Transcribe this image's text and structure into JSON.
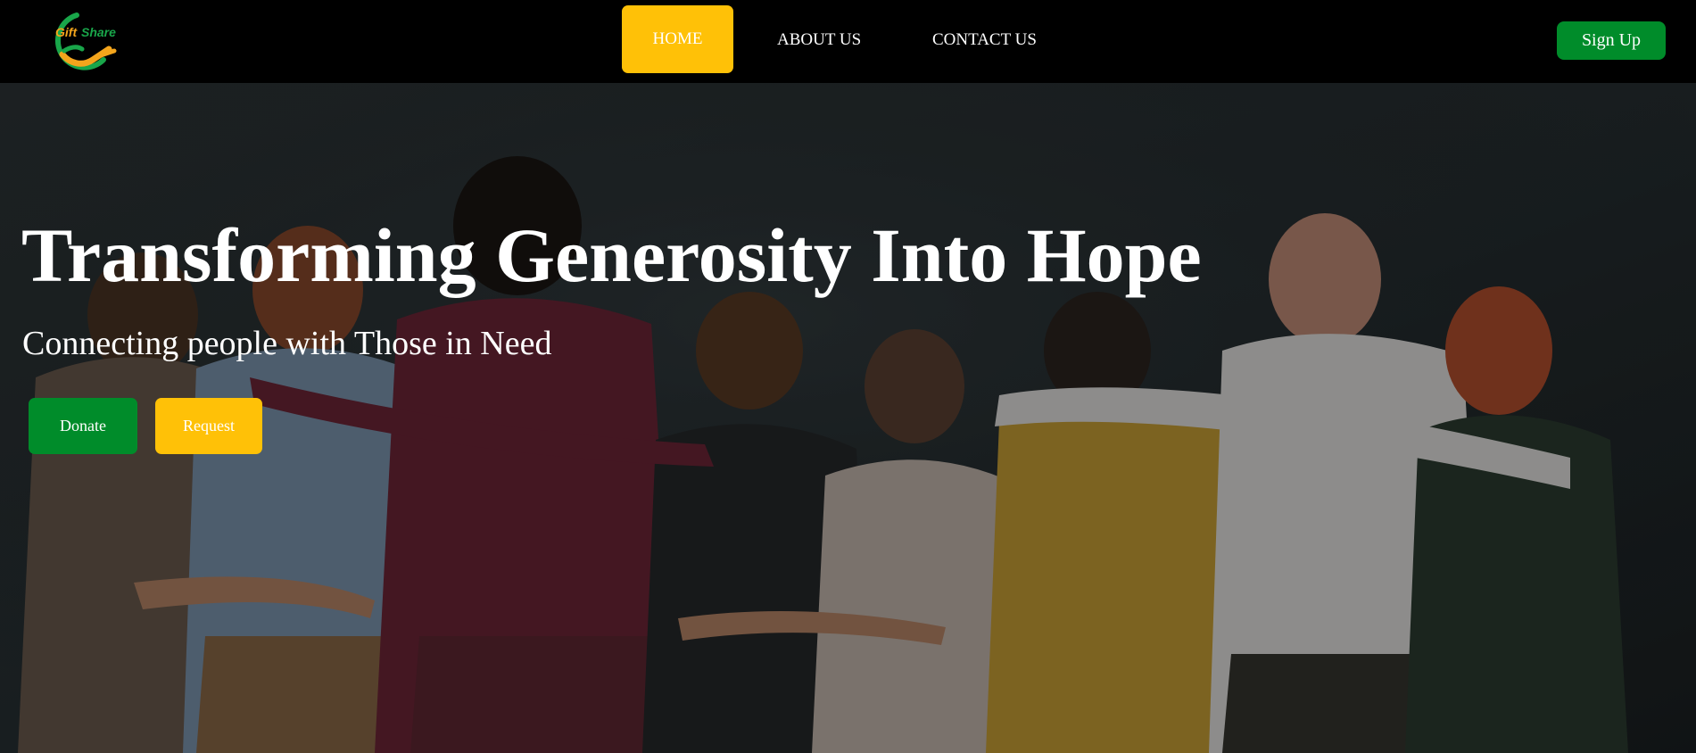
{
  "brand": {
    "name_part1": "Gift",
    "name_part2": "Share",
    "colors": {
      "green": "#008c2a",
      "yellow": "#ffc107",
      "nav_background": "#000000"
    }
  },
  "nav": {
    "items": [
      {
        "label": "HOME",
        "active": true
      },
      {
        "label": "ABOUT US",
        "active": false
      },
      {
        "label": "CONTACT US",
        "active": false
      }
    ],
    "signup_label": "Sign Up"
  },
  "hero": {
    "title": "Transforming Generosity Into Hope",
    "subtitle": "Connecting people with Those in Need",
    "buttons": {
      "donate_label": "Donate",
      "request_label": "Request"
    }
  }
}
